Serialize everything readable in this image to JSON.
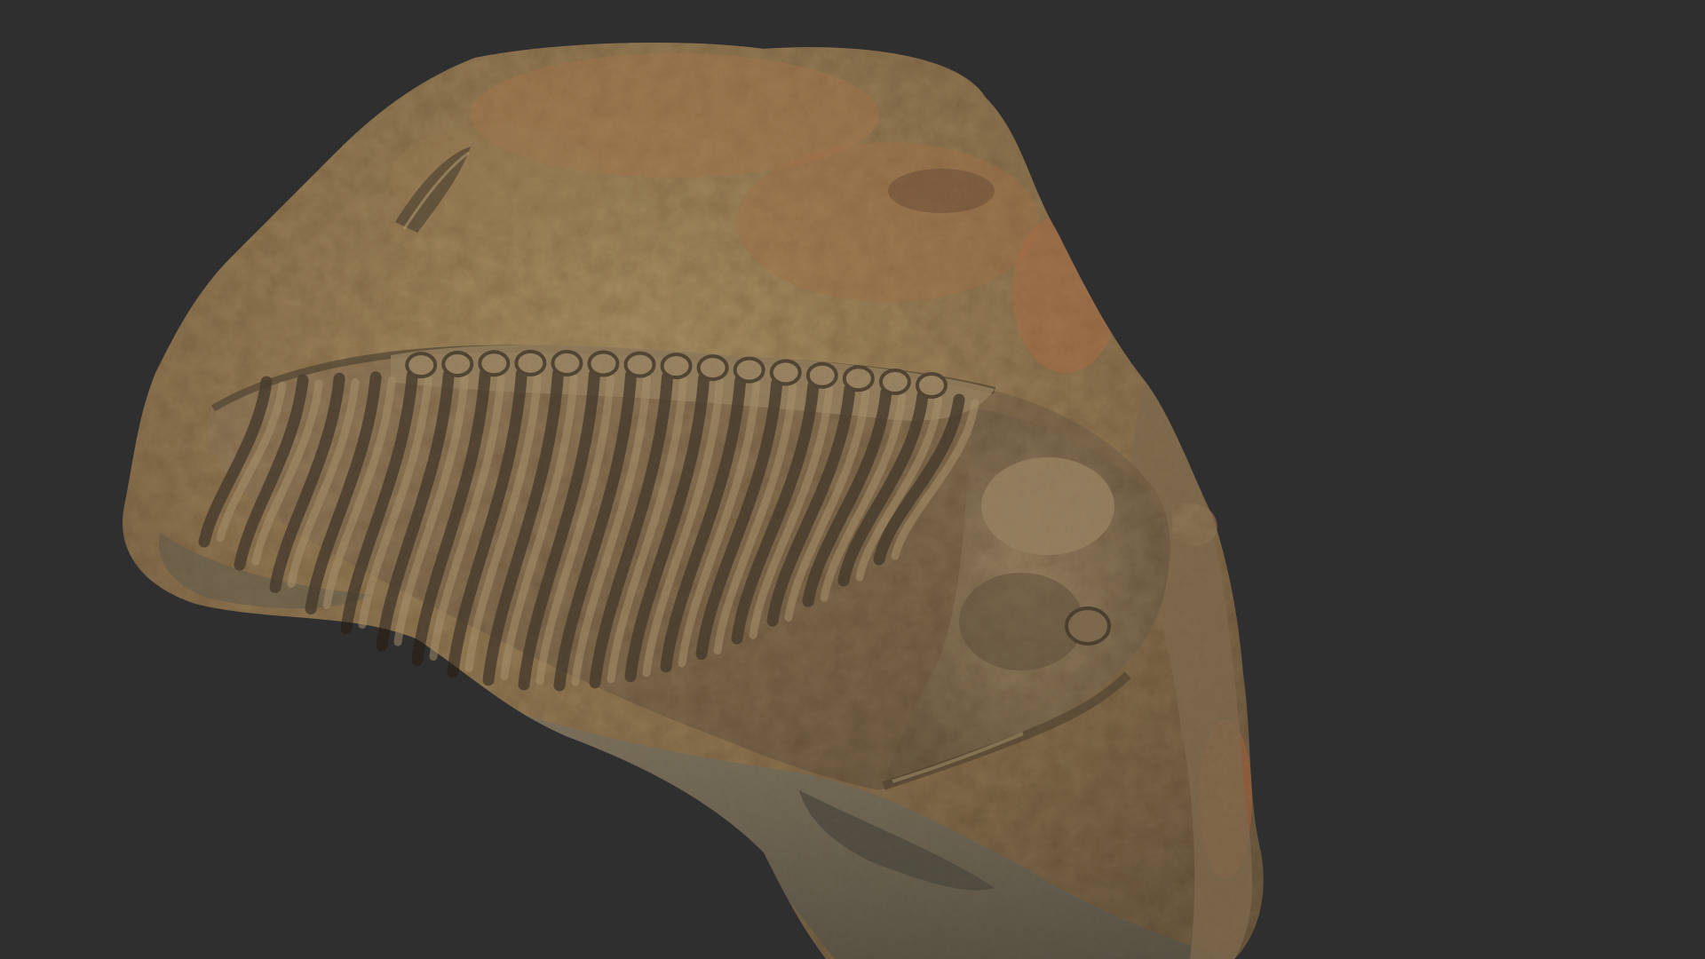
{
  "scene": {
    "subject": "trilobite-fossil-on-rock",
    "colors": {
      "background": "#2f2f30",
      "rock_light": "#a08458",
      "rock_mid": "#7d6443",
      "rock_dark": "#4a3c2a",
      "rock_grey": "#59594f",
      "rust": "#a0613a",
      "fossil_shadow": "#2e261c"
    }
  }
}
